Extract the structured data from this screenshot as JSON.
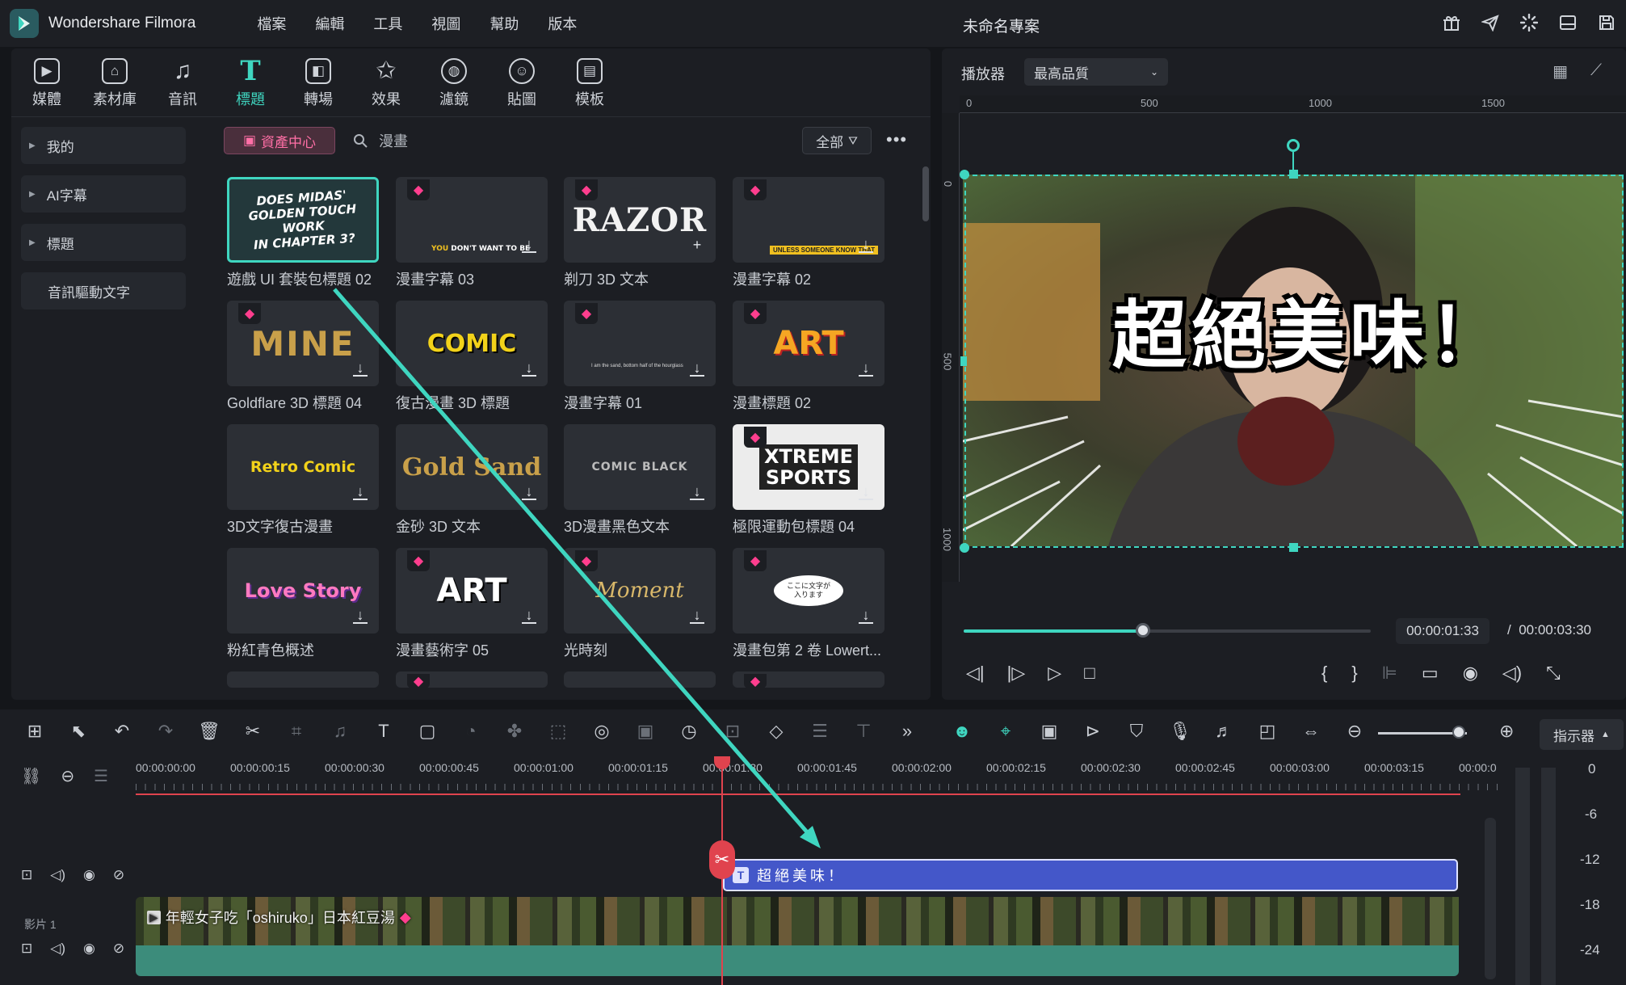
{
  "app": {
    "title": "Wondershare Filmora",
    "project_title": "未命名專案"
  },
  "menu": [
    "檔案",
    "編輯",
    "工具",
    "視圖",
    "幫助",
    "版本"
  ],
  "top_icons": [
    "gift-icon",
    "send-icon",
    "loading-icon",
    "layout-icon",
    "save-icon"
  ],
  "tools": [
    {
      "label": "媒體",
      "icon": "media-icon"
    },
    {
      "label": "素材庫",
      "icon": "stock-icon"
    },
    {
      "label": "音訊",
      "icon": "audio-icon"
    },
    {
      "label": "標題",
      "icon": "title-icon",
      "active": true
    },
    {
      "label": "轉場",
      "icon": "transition-icon"
    },
    {
      "label": "效果",
      "icon": "effects-icon"
    },
    {
      "label": "濾鏡",
      "icon": "filter-icon"
    },
    {
      "label": "貼圖",
      "icon": "sticker-icon"
    },
    {
      "label": "模板",
      "icon": "template-icon"
    }
  ],
  "sidebar": [
    {
      "label": "我的"
    },
    {
      "label": "AI字幕"
    },
    {
      "label": "標題"
    },
    {
      "label": "音訊驅動文字"
    }
  ],
  "asset_center": "資產中心",
  "search": {
    "value": "漫畫"
  },
  "filter": {
    "label": "全部"
  },
  "cards": [
    {
      "caption": "遊戲 UI 套裝包標題 02",
      "thumb": "DOES MIDAS' GOLDEN TOUCH WORK IN CHAPTER 3?"
    },
    {
      "caption": "漫畫字幕 03",
      "thumb": "YOU DON'T WANT TO BE"
    },
    {
      "caption": "剃刀 3D 文本",
      "thumb": "RAZOR"
    },
    {
      "caption": "漫畫字幕 02",
      "thumb": "UNLESS SOMEONE KNOW THAT"
    },
    {
      "caption": "Goldflare 3D 標題 04",
      "thumb": "MINE"
    },
    {
      "caption": "復古漫畫 3D 標題",
      "thumb": "COMIC"
    },
    {
      "caption": "漫畫字幕 01",
      "thumb": "I am the sand, bottom half of the hourglass"
    },
    {
      "caption": "漫畫標題 02",
      "thumb": "ART"
    },
    {
      "caption": "3D文字復古漫畫",
      "thumb": "Retro Comic"
    },
    {
      "caption": "金砂 3D 文本",
      "thumb": "Gold Sand"
    },
    {
      "caption": "3D漫畫黑色文本",
      "thumb": "COMIC BLACK"
    },
    {
      "caption": "極限運動包標題 04",
      "thumb": "XTREME SPORTS"
    },
    {
      "caption": "粉紅青色概述",
      "thumb": "Love Story"
    },
    {
      "caption": "漫畫藝術字 05",
      "thumb": "ART"
    },
    {
      "caption": "光時刻",
      "thumb": "Moment"
    },
    {
      "caption": "漫畫包第 2 卷 Lowert...",
      "thumb": "ここに文字が入ります"
    }
  ],
  "player": {
    "label": "播放器",
    "quality": "最高品質",
    "ruler_h": [
      "0",
      "500",
      "1000",
      "1500"
    ],
    "ruler_v": [
      "0",
      "500",
      "1000"
    ],
    "overlay_text": "超絕美味！",
    "current_time": "00:00:01:33",
    "separator": "/",
    "total_time": "00:00:03:30",
    "progress": 0.44
  },
  "timeline": {
    "ruler": [
      "00:00:00:00",
      "00:00:00:15",
      "00:00:00:30",
      "00:00:00:45",
      "00:00:01:00",
      "00:00:01:15",
      "00:00:01:30",
      "00:00:01:45",
      "00:00:02:00",
      "00:00:02:15",
      "00:00:02:30",
      "00:00:02:45",
      "00:00:03:00",
      "00:00:03:15",
      "00:00:0"
    ],
    "indicator_label": "指示器",
    "title_clip": "超絕美味！",
    "video_clip": "年輕女子吃「oshiruko」日本紅豆湯",
    "track_label": "影片 1",
    "meter_labels": [
      "0",
      "-6",
      "-12",
      "-18",
      "-24"
    ]
  },
  "colors": {
    "accent": "#3fd6c0",
    "playhead": "#e0434e",
    "title_clip": "#4457c9",
    "audio": "#3c8c7b"
  }
}
